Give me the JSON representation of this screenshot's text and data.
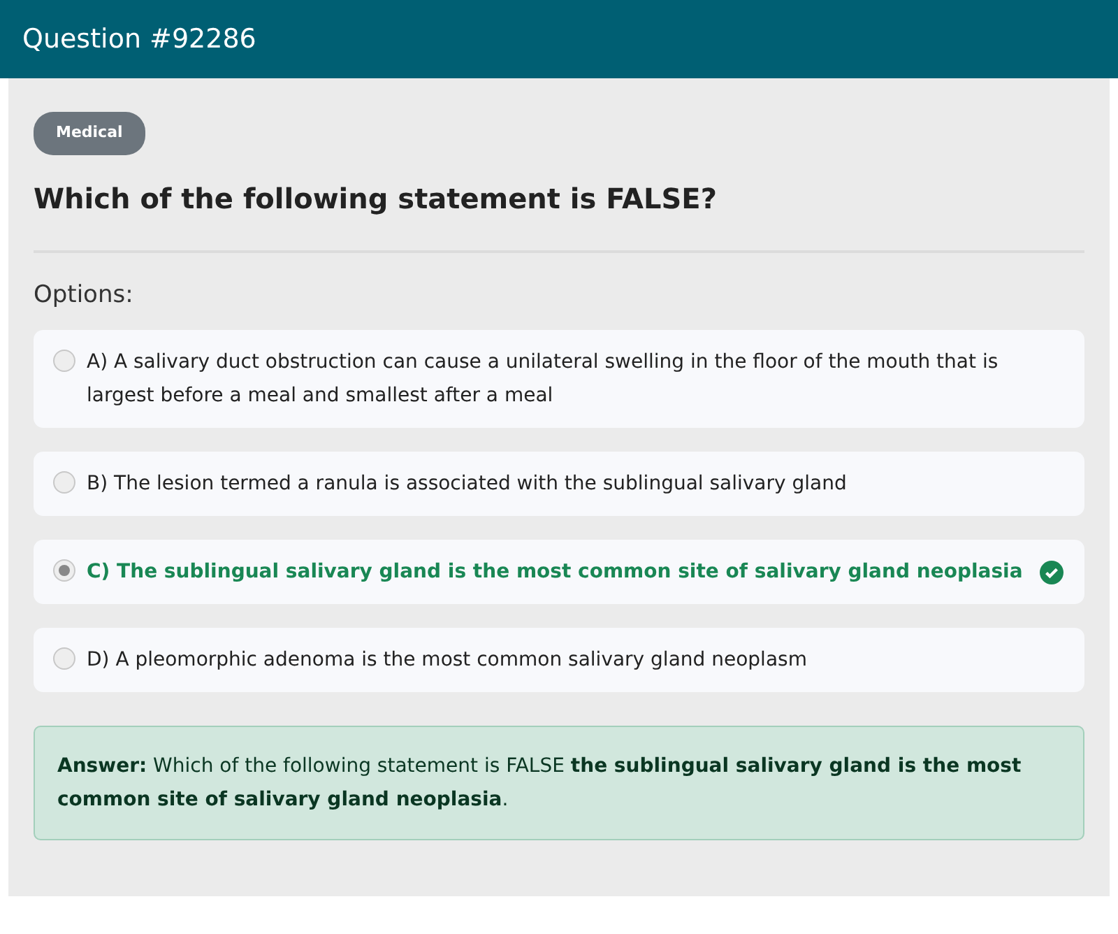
{
  "header": {
    "title": "Question #92286"
  },
  "category": "Medical",
  "question": "Which of the following statement is FALSE?",
  "options_label": "Options:",
  "options": [
    {
      "text": "A) A salivary duct obstruction can cause a unilateral swelling in the floor of the mouth that is largest before a meal and smallest after a meal",
      "selected": false,
      "correct": false
    },
    {
      "text": "B) The lesion termed a ranula is associated with the sublingual salivary gland",
      "selected": false,
      "correct": false
    },
    {
      "text": "C) The sublingual salivary gland is the most common site of salivary gland neoplasia",
      "selected": true,
      "correct": true
    },
    {
      "text": "D) A pleomorphic adenoma is the most common salivary gland neoplasm",
      "selected": false,
      "correct": false
    }
  ],
  "answer": "**Answer:** Which of the following statement is FALSE **the sublingual salivary gland is the most common site of salivary gland neoplasia**."
}
